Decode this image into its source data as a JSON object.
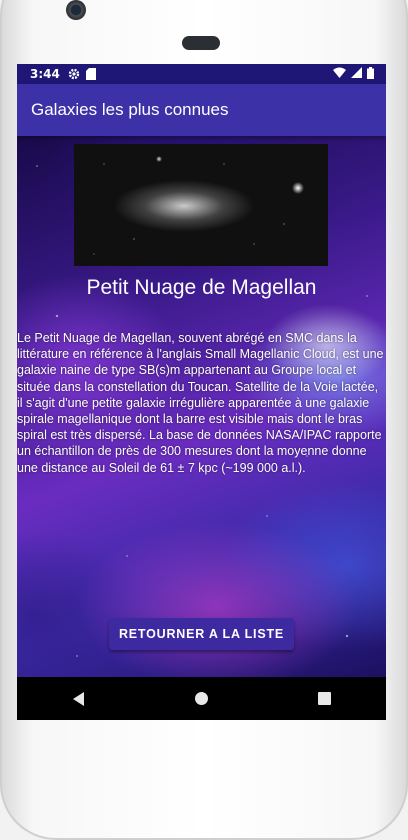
{
  "status_bar": {
    "time": "3:44",
    "icons": [
      "gear-icon",
      "sd-card-icon",
      "wifi-icon",
      "signal-icon",
      "battery-icon"
    ]
  },
  "app_bar": {
    "title": "Galaxies les plus connues"
  },
  "galaxy": {
    "image_icon": "galaxy-photo",
    "name": "Petit Nuage de Magellan",
    "description": "Le Petit Nuage de Magellan, souvent abrégé en SMC dans la littérature en référence à l'anglais Small Magellanic Cloud, est une galaxie naine de type SB(s)m appartenant au Groupe local et située dans la constellation du Toucan. Satellite de la Voie lactée, il s'agit d'une petite galaxie irrégulière apparentée à une galaxie spirale magellanique dont la barre est visible mais dont le bras spiral est très dispersé. La base de données NASA/IPAC rapporte un échantillon de près de 300 mesures dont la moyenne donne une distance au Soleil de 61 ± 7 kpc (~199 000 a.l.)."
  },
  "actions": {
    "back_label": "RETOURNER A LA LISTE"
  },
  "nav": {
    "icons": [
      "back-icon",
      "home-icon",
      "recents-icon"
    ]
  },
  "colors": {
    "status_bar": "#1e1775",
    "app_bar": "#3d31a8",
    "button": "#3d2aa0"
  }
}
